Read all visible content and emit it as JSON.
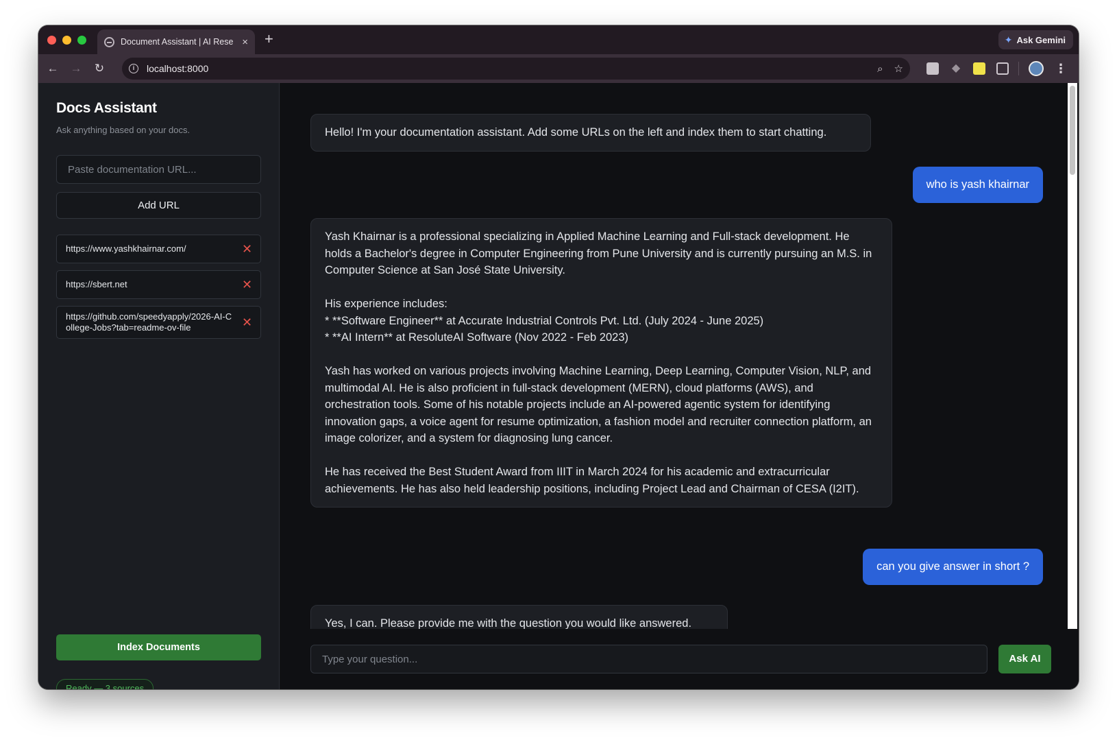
{
  "browser": {
    "tab_title": "Document Assistant | AI Rese",
    "tab_close": "×",
    "new_tab": "+",
    "ask_gemini": "Ask Gemini",
    "url": "localhost:8000"
  },
  "sidebar": {
    "title": "Docs Assistant",
    "subtitle": "Ask anything based on your docs.",
    "url_placeholder": "Paste documentation URL...",
    "add_url_label": "Add URL",
    "urls": [
      {
        "url": "https://www.yashkhairnar.com/",
        "remove": "✕"
      },
      {
        "url": "https://sbert.net",
        "remove": "✕"
      },
      {
        "url": "https://github.com/speedyapply/2026-AI-College-Jobs?tab=readme-ov-file",
        "remove": "✕"
      }
    ],
    "index_label": "Index Documents",
    "status": "Ready — 3 sources"
  },
  "chat": {
    "messages": [
      {
        "role": "ai",
        "paragraphs": [
          "Hello! I'm your documentation assistant. Add some URLs on the left and index them to start chatting."
        ]
      },
      {
        "role": "user",
        "text": "who is yash khairnar"
      },
      {
        "role": "ai",
        "paragraphs": [
          "Yash Khairnar is a professional specializing in Applied Machine Learning and Full-stack development. He holds a Bachelor's degree in Computer Engineering from Pune University and is currently pursuing an M.S. in Computer Science at San José State University.",
          "His experience includes:\n* **Software Engineer** at Accurate Industrial Controls Pvt. Ltd. (July 2024 - June 2025)\n* **AI Intern** at ResoluteAI Software (Nov 2022 - Feb 2023)",
          "Yash has worked on various projects involving Machine Learning, Deep Learning, Computer Vision, NLP, and multimodal AI. He is also proficient in full-stack development (MERN), cloud platforms (AWS), and orchestration tools. Some of his notable projects include an AI-powered agentic system for identifying innovation gaps, a voice agent for resume optimization, a fashion model and recruiter connection platform, an image colorizer, and a system for diagnosing lung cancer.",
          "He has received the Best Student Award from IIIT in March 2024 for his academic and extracurricular achievements. He has also held leadership positions, including Project Lead and Chairman of CESA (I2IT)."
        ]
      },
      {
        "role": "user",
        "text": "can you give answer in short ?"
      },
      {
        "role": "ai",
        "paragraphs": [
          "Yes, I can. Please provide me with the question you would like answered."
        ]
      }
    ],
    "question_placeholder": "Type your question...",
    "ask_label": "Ask AI"
  }
}
